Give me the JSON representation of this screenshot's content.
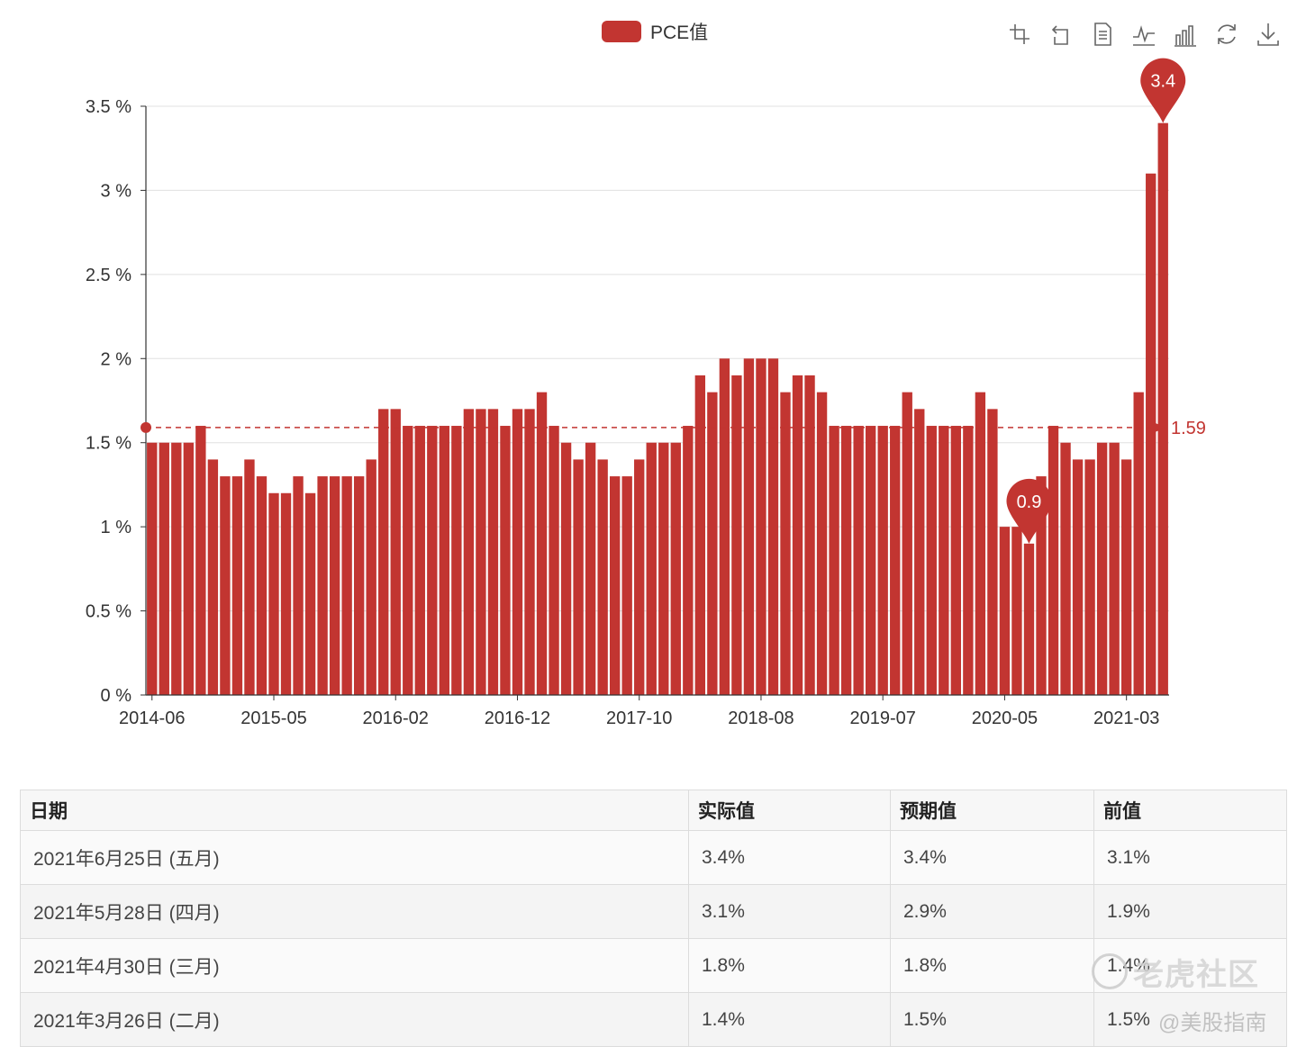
{
  "legend": {
    "label": "PCE值",
    "color": "#c23531"
  },
  "toolbox": [
    {
      "name": "zoom-icon"
    },
    {
      "name": "zoom-reset-icon"
    },
    {
      "name": "data-view-icon"
    },
    {
      "name": "line-chart-icon"
    },
    {
      "name": "bar-chart-icon"
    },
    {
      "name": "restore-icon"
    },
    {
      "name": "download-icon"
    }
  ],
  "chart_data": {
    "type": "bar",
    "series": [
      {
        "name": "PCE值",
        "color": "#c23531",
        "values": [
          1.5,
          1.5,
          1.5,
          1.5,
          1.6,
          1.4,
          1.3,
          1.3,
          1.4,
          1.3,
          1.2,
          1.2,
          1.3,
          1.2,
          1.3,
          1.3,
          1.3,
          1.3,
          1.4,
          1.7,
          1.7,
          1.6,
          1.6,
          1.6,
          1.6,
          1.6,
          1.7,
          1.7,
          1.7,
          1.6,
          1.7,
          1.7,
          1.8,
          1.6,
          1.5,
          1.4,
          1.5,
          1.4,
          1.3,
          1.3,
          1.4,
          1.5,
          1.5,
          1.5,
          1.6,
          1.9,
          1.8,
          2.0,
          1.9,
          2.0,
          2.0,
          2.0,
          1.8,
          1.9,
          1.9,
          1.8,
          1.6,
          1.6,
          1.6,
          1.6,
          1.6,
          1.6,
          1.8,
          1.7,
          1.6,
          1.6,
          1.6,
          1.6,
          1.8,
          1.7,
          1.0,
          1.0,
          0.9,
          1.3,
          1.6,
          1.5,
          1.4,
          1.4,
          1.5,
          1.5,
          1.4,
          1.8,
          3.1,
          3.4
        ]
      }
    ],
    "x_start": "2014-06",
    "x_tick_labels": [
      "2014-06",
      "2015-05",
      "2016-02",
      "2016-12",
      "2017-10",
      "2018-08",
      "2019-07",
      "2020-05",
      "2021-03"
    ],
    "x_tick_indices": [
      0,
      10,
      20,
      30,
      40,
      50,
      60,
      70,
      80
    ],
    "y_ticks": [
      "0 %",
      "0.5 %",
      "1 %",
      "1.5 %",
      "2 %",
      "2.5 %",
      "3 %",
      "3.5 %"
    ],
    "ylim": [
      0,
      3.5
    ],
    "mark_points": [
      {
        "type": "max",
        "index": 83,
        "value": 3.4,
        "label": "3.4"
      },
      {
        "type": "min",
        "index": 72,
        "value": 0.9,
        "label": "0.9"
      }
    ],
    "mark_line": {
      "type": "average",
      "value": 1.59,
      "label": "1.59"
    },
    "grid": "horizontal"
  },
  "table": {
    "headers": [
      "日期",
      "实际值",
      "预期值",
      "前值"
    ],
    "rows": [
      [
        "2021年6月25日 (五月)",
        "3.4%",
        "3.4%",
        "3.1%"
      ],
      [
        "2021年5月28日 (四月)",
        "3.1%",
        "2.9%",
        "1.9%"
      ],
      [
        "2021年4月30日 (三月)",
        "1.8%",
        "1.8%",
        "1.4%"
      ],
      [
        "2021年3月26日 (二月)",
        "1.4%",
        "1.5%",
        "1.5%"
      ]
    ]
  },
  "watermark": {
    "brand": "老虎社区",
    "sub": "@美股指南"
  }
}
